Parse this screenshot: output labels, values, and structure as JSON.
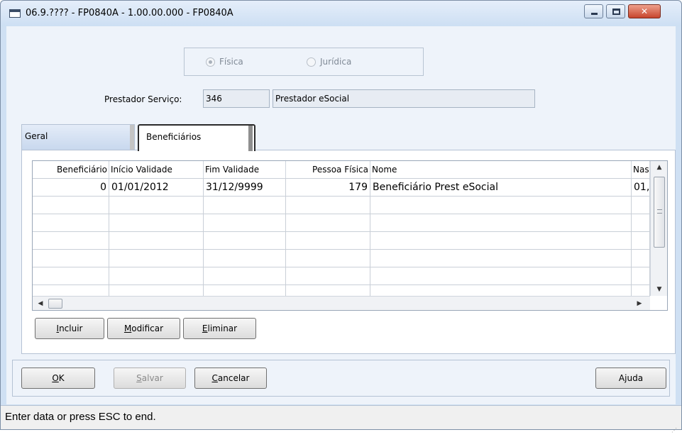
{
  "window": {
    "title": "06.9.???? - FP0840A - 1.00.00.000 - FP0840A"
  },
  "person_type": {
    "options": [
      {
        "label": "Física",
        "selected": true
      },
      {
        "label": "Jurídica",
        "selected": false
      }
    ]
  },
  "provider": {
    "label": "Prestador Serviço:",
    "code": "346",
    "name": "Prestador eSocial"
  },
  "tabs": [
    {
      "label": "Geral",
      "active": false
    },
    {
      "label": "Beneficiários",
      "active": true
    }
  ],
  "grid": {
    "columns": [
      "Beneficiário",
      "Início Validade",
      "Fim Validade",
      "Pessoa Física",
      "Nome",
      "Nas"
    ],
    "rows": [
      [
        "0",
        "01/01/2012",
        "31/12/9999",
        "179",
        "Beneficiário Prest eSocial",
        "01,"
      ],
      [
        "",
        "",
        "",
        "",
        "",
        ""
      ],
      [
        "",
        "",
        "",
        "",
        "",
        ""
      ],
      [
        "",
        "",
        "",
        "",
        "",
        ""
      ],
      [
        "",
        "",
        "",
        "",
        "",
        ""
      ],
      [
        "",
        "",
        "",
        "",
        "",
        ""
      ],
      [
        "",
        "",
        "",
        "",
        "",
        ""
      ]
    ]
  },
  "grid_buttons": {
    "incluir_first": "I",
    "incluir_rest": "ncluir",
    "modificar_first": "M",
    "modificar_rest": "odificar",
    "eliminar_first": "E",
    "eliminar_rest": "liminar"
  },
  "actions": {
    "ok_first": "O",
    "ok_rest": "K",
    "salvar_first": "S",
    "salvar_rest": "alvar",
    "cancelar_first": "C",
    "cancelar_rest": "ancelar",
    "ajuda_pre": "A",
    "ajuda_under": "j",
    "ajuda_rest": "uda"
  },
  "status": {
    "message": "Enter data or press ESC to end."
  }
}
